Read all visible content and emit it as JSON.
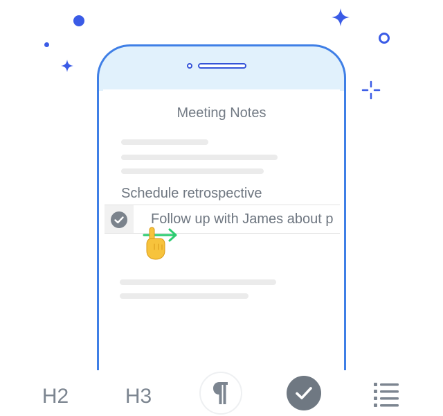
{
  "note": {
    "title": "Meeting Notes",
    "task_text": "Schedule retrospective",
    "swipe_row_text": "Follow up with James about p"
  },
  "toolbar": {
    "h2_label": "H2",
    "h3_label": "H3",
    "paragraph_icon": "paragraph-icon",
    "checkbox_icon": "checkmark-circle-icon",
    "list_icon": "bullet-list-icon"
  },
  "colors": {
    "accent_blue": "#3f7fe6",
    "sparkle_blue": "#3a5be6",
    "swipe_green": "#2ecc71",
    "text_gray": "#737b85",
    "check_gray": "#6f7882"
  }
}
